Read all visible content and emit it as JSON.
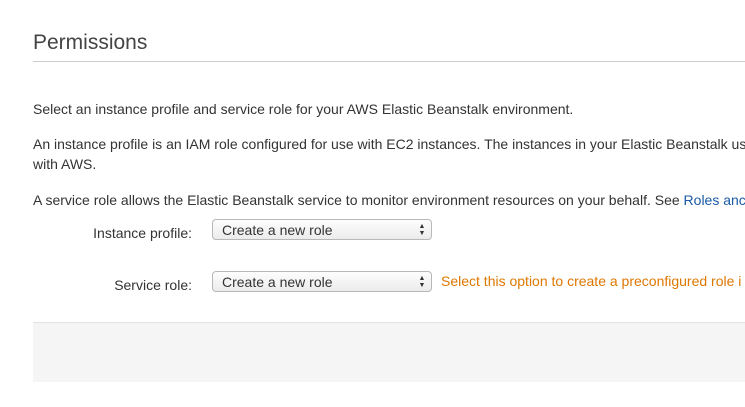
{
  "section": {
    "title": "Permissions"
  },
  "paragraphs": {
    "p1": "Select an instance profile and service role for your AWS Elastic Beanstalk environment.",
    "p2_line1": "An instance profile is an IAM role configured for use with EC2 instances. The instances in your Elastic Beanstalk us",
    "p2_line2": "with AWS.",
    "p3_text": "A service role allows the Elastic Beanstalk service to monitor environment resources on your behalf. See ",
    "p3_link": "Roles anc"
  },
  "form": {
    "instance_profile": {
      "label": "Instance profile:",
      "selected": "Create a new role"
    },
    "service_role": {
      "label": "Service role:",
      "selected": "Create a new role",
      "hint": "Select this option to create a preconfigured role i"
    }
  },
  "icons": {
    "select_arrows": "updown-arrows-icon"
  },
  "colors": {
    "link": "#1a5aa6",
    "hint": "#dd7700",
    "rule": "#cccccc",
    "panel": "#f5f5f5"
  }
}
